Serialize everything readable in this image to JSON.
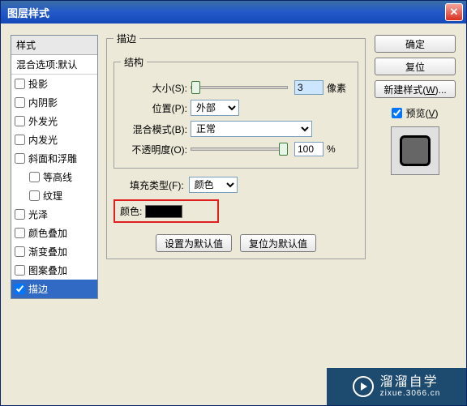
{
  "titlebar": {
    "title": "图层样式"
  },
  "left": {
    "header": "样式",
    "blend": "混合选项:默认",
    "items": [
      {
        "label": "投影",
        "checked": false
      },
      {
        "label": "内阴影",
        "checked": false
      },
      {
        "label": "外发光",
        "checked": false
      },
      {
        "label": "内发光",
        "checked": false
      },
      {
        "label": "斜面和浮雕",
        "checked": false
      },
      {
        "label": "等高线",
        "checked": false,
        "indent": true
      },
      {
        "label": "纹理",
        "checked": false,
        "indent": true
      },
      {
        "label": "光泽",
        "checked": false
      },
      {
        "label": "颜色叠加",
        "checked": false
      },
      {
        "label": "渐变叠加",
        "checked": false
      },
      {
        "label": "图案叠加",
        "checked": false
      },
      {
        "label": "描边",
        "checked": true,
        "selected": true
      }
    ]
  },
  "center": {
    "outer_legend": "描边",
    "inner_legend": "结构",
    "size_label": "大小(S):",
    "size_value": "3",
    "size_unit": "像素",
    "position_label": "位置(P):",
    "position_value": "外部",
    "blendmode_label": "混合模式(B):",
    "blendmode_value": "正常",
    "opacity_label": "不透明度(O):",
    "opacity_value": "100",
    "opacity_unit": "%",
    "filltype_label": "填充类型(F):",
    "filltype_value": "颜色",
    "color_label": "颜色:",
    "color_value": "#000000",
    "btn_default": "设置为默认值",
    "btn_reset": "复位为默认值"
  },
  "right": {
    "ok": "确定",
    "reset": "复位",
    "newstyle": "新建样式(W)...",
    "preview_label": "预览(V)",
    "preview_checked": true
  },
  "watermark": {
    "brand": "溜溜自学",
    "sub": "zixue.3066.cn"
  }
}
